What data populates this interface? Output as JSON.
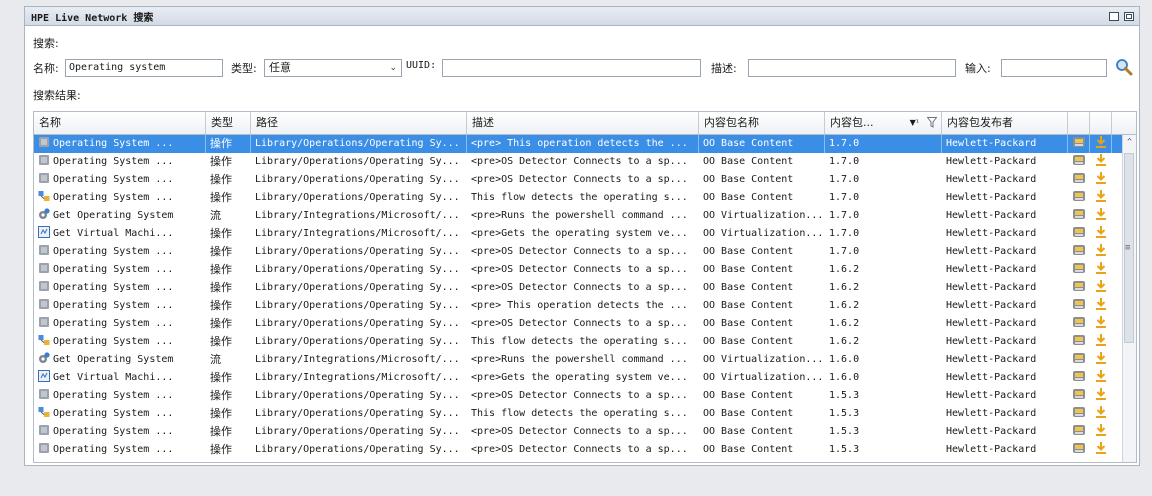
{
  "window": {
    "title": "HPE Live Network 搜索"
  },
  "search": {
    "section_label": "搜索:",
    "name_label": "名称:",
    "name_value": "Operating system",
    "type_label": "类型:",
    "type_value": "任意",
    "uuid_label": "UUID:",
    "uuid_value": "",
    "desc_label": "描述:",
    "desc_value": "",
    "input_label": "输入:",
    "input_value": ""
  },
  "results": {
    "label": "搜索结果:",
    "columns": [
      "名称",
      "类型",
      "路径",
      "描述",
      "内容包名称",
      "内容包...",
      "内容包发布者"
    ],
    "sort_indicator": "▼¹",
    "rows": [
      {
        "icon": "op",
        "name": "Operating System ...",
        "type": "操作",
        "path": "Library/Operations/Operating Sy...",
        "desc": "<pre> This operation detects the ...",
        "pack": "OO Base Content",
        "ver": "1.7.0",
        "pub": "Hewlett-Packard",
        "selected": true
      },
      {
        "icon": "op",
        "name": "Operating System ...",
        "type": "操作",
        "path": "Library/Operations/Operating Sy...",
        "desc": "<pre>OS Detector Connects to a sp...",
        "pack": "OO Base Content",
        "ver": "1.7.0",
        "pub": "Hewlett-Packard"
      },
      {
        "icon": "op",
        "name": "Operating System ...",
        "type": "操作",
        "path": "Library/Operations/Operating Sy...",
        "desc": "<pre>OS Detector Connects to a sp...",
        "pack": "OO Base Content",
        "ver": "1.7.0",
        "pub": "Hewlett-Packard"
      },
      {
        "icon": "flow",
        "name": "Operating System ...",
        "type": "操作",
        "path": "Library/Operations/Operating Sy...",
        "desc": "This flow detects the operating s...",
        "pack": "OO Base Content",
        "ver": "1.7.0",
        "pub": "Hewlett-Packard"
      },
      {
        "icon": "gear",
        "name": "Get Operating System",
        "type": "流",
        "path": "Library/Integrations/Microsoft/...",
        "desc": "<pre>Runs the powershell command ...",
        "pack": "OO Virtualization...",
        "ver": "1.7.0",
        "pub": "Hewlett-Packard"
      },
      {
        "icon": "vm",
        "name": "Get Virtual Machi...",
        "type": "操作",
        "path": "Library/Integrations/Microsoft/...",
        "desc": "<pre>Gets the operating system ve...",
        "pack": "OO Virtualization...",
        "ver": "1.7.0",
        "pub": "Hewlett-Packard"
      },
      {
        "icon": "op",
        "name": "Operating System ...",
        "type": "操作",
        "path": "Library/Operations/Operating Sy...",
        "desc": "<pre>OS Detector Connects to a sp...",
        "pack": "OO Base Content",
        "ver": "1.7.0",
        "pub": "Hewlett-Packard"
      },
      {
        "icon": "op",
        "name": "Operating System ...",
        "type": "操作",
        "path": "Library/Operations/Operating Sy...",
        "desc": "<pre>OS Detector Connects to a sp...",
        "pack": "OO Base Content",
        "ver": "1.6.2",
        "pub": "Hewlett-Packard"
      },
      {
        "icon": "op",
        "name": "Operating System ...",
        "type": "操作",
        "path": "Library/Operations/Operating Sy...",
        "desc": "<pre>OS Detector Connects to a sp...",
        "pack": "OO Base Content",
        "ver": "1.6.2",
        "pub": "Hewlett-Packard"
      },
      {
        "icon": "op",
        "name": "Operating System ...",
        "type": "操作",
        "path": "Library/Operations/Operating Sy...",
        "desc": "<pre> This operation detects the ...",
        "pack": "OO Base Content",
        "ver": "1.6.2",
        "pub": "Hewlett-Packard"
      },
      {
        "icon": "op",
        "name": "Operating System ...",
        "type": "操作",
        "path": "Library/Operations/Operating Sy...",
        "desc": "<pre>OS Detector Connects to a sp...",
        "pack": "OO Base Content",
        "ver": "1.6.2",
        "pub": "Hewlett-Packard"
      },
      {
        "icon": "flow",
        "name": "Operating System ...",
        "type": "操作",
        "path": "Library/Operations/Operating Sy...",
        "desc": "This flow detects the operating s...",
        "pack": "OO Base Content",
        "ver": "1.6.2",
        "pub": "Hewlett-Packard"
      },
      {
        "icon": "gear",
        "name": "Get Operating System",
        "type": "流",
        "path": "Library/Integrations/Microsoft/...",
        "desc": "<pre>Runs the powershell command ...",
        "pack": "OO Virtualization...",
        "ver": "1.6.0",
        "pub": "Hewlett-Packard"
      },
      {
        "icon": "vm",
        "name": "Get Virtual Machi...",
        "type": "操作",
        "path": "Library/Integrations/Microsoft/...",
        "desc": "<pre>Gets the operating system ve...",
        "pack": "OO Virtualization...",
        "ver": "1.6.0",
        "pub": "Hewlett-Packard"
      },
      {
        "icon": "op",
        "name": "Operating System ...",
        "type": "操作",
        "path": "Library/Operations/Operating Sy...",
        "desc": "<pre>OS Detector Connects to a sp...",
        "pack": "OO Base Content",
        "ver": "1.5.3",
        "pub": "Hewlett-Packard"
      },
      {
        "icon": "flow",
        "name": "Operating System ...",
        "type": "操作",
        "path": "Library/Operations/Operating Sy...",
        "desc": "This flow detects the operating s...",
        "pack": "OO Base Content",
        "ver": "1.5.3",
        "pub": "Hewlett-Packard"
      },
      {
        "icon": "op",
        "name": "Operating System ...",
        "type": "操作",
        "path": "Library/Operations/Operating Sy...",
        "desc": "<pre>OS Detector Connects to a sp...",
        "pack": "OO Base Content",
        "ver": "1.5.3",
        "pub": "Hewlett-Packard"
      },
      {
        "icon": "op",
        "name": "Operating System ...",
        "type": "操作",
        "path": "Library/Operations/Operating Sy...",
        "desc": "<pre>OS Detector Connects to a sp...",
        "pack": "OO Base Content",
        "ver": "1.5.3",
        "pub": "Hewlett-Packard"
      }
    ]
  },
  "colors": {
    "selected_row": "#3b8ee6",
    "accent_download": "#e8a317"
  }
}
